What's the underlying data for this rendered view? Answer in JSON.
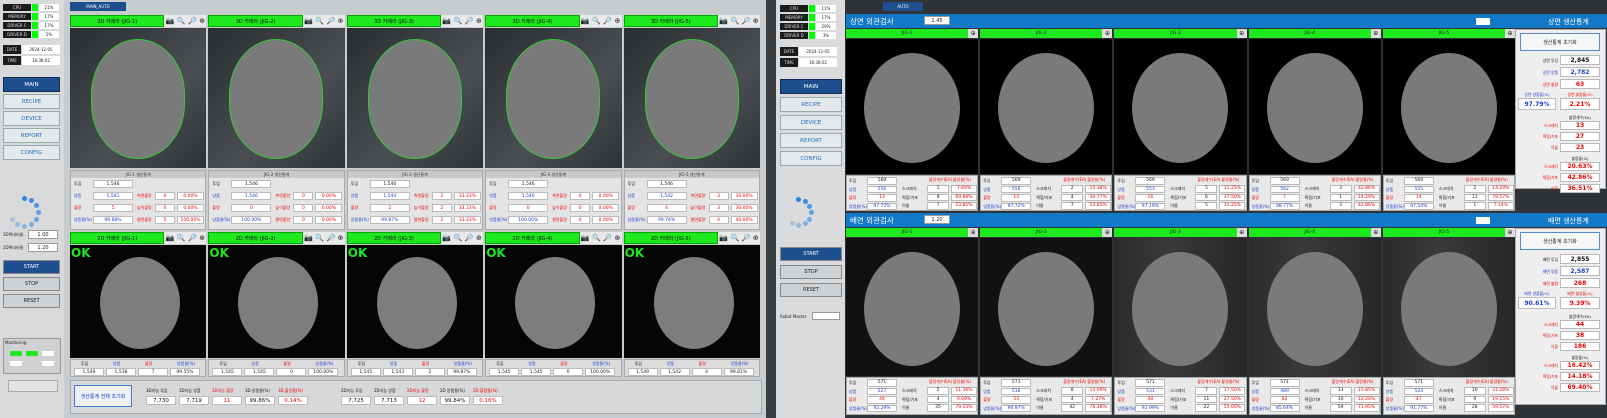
{
  "left": {
    "mode_tab": "MAIN_AUTO",
    "sys": [
      {
        "label": "CPU",
        "value": "21%"
      },
      {
        "label": "MEMORY",
        "value": "17%"
      },
      {
        "label": "DRIVER C",
        "value": "17%"
      },
      {
        "label": "DRIVER D",
        "value": "5%"
      }
    ],
    "date_label": "DATE",
    "date": "2024-12-05",
    "time_label": "TIME",
    "time": "16:38:02",
    "nav": [
      "MAIN",
      "RECIPE",
      "DEVICE",
      "REPORT",
      "CONFIG"
    ],
    "ctrl": [
      "START",
      "STOP",
      "RESET"
    ],
    "z1_label": "3D확대비율",
    "z1": "1.00",
    "z2_label": "2D확대비율",
    "z2": "1.20",
    "monitoring": "Monitoring",
    "cams3d": [
      "3D 카메라 (JIG-1)",
      "3D 카메라 (JIG-2)",
      "3D 카메라 (JIG-3)",
      "3D 카메라 (JIG-4)",
      "3D 카메라 (JIG-5)"
    ],
    "cams2d": [
      "2D 카메라 (JIG-1)",
      "2D 카메라 (JIG-2)",
      "2D 카메라 (JIG-3)",
      "2D 카메라 (JIG-4)",
      "2D 카메라 (JIG-5)"
    ],
    "ok": "OK",
    "stats3d": [
      {
        "title": "JIG-1 생산통계",
        "in": "1,546",
        "good": "1,541",
        "ng": "5",
        "rate": "99.68%",
        "bad1": "0",
        "p1": "0.00%",
        "bad2": "0",
        "p2": "0.00%",
        "bad3": "5",
        "p3": "100.00%"
      },
      {
        "title": "JIG-2 생산통계",
        "in": "1,546",
        "good": "1,546",
        "ng": "0",
        "rate": "100.00%",
        "bad1": "0",
        "p1": "0.00%",
        "bad2": "0",
        "p2": "0.00%",
        "bad3": "0",
        "p3": "0.00%"
      },
      {
        "title": "JIG-3 생산통계",
        "in": "1,546",
        "good": "1,544",
        "ng": "2",
        "rate": "99.87%",
        "bad1": "2",
        "p1": "33.33%",
        "bad2": "2",
        "p2": "33.33%",
        "bad3": "2",
        "p3": "33.33%"
      },
      {
        "title": "JIG-4 생산통계",
        "in": "1,546",
        "good": "1,546",
        "ng": "0",
        "rate": "100.00%",
        "bad1": "0",
        "p1": "0.00%",
        "bad2": "0",
        "p2": "0.00%",
        "bad3": "0",
        "p3": "0.00%"
      },
      {
        "title": "JIG-5 생산통계",
        "in": "1,546",
        "good": "1,542",
        "ng": "4",
        "rate": "99.74%",
        "bad1": "3",
        "p1": "30.00%",
        "bad2": "3",
        "p2": "30.00%",
        "bad3": "4",
        "p3": "40.00%"
      }
    ],
    "stats2d": [
      {
        "in": "1,549",
        "good": "1,538",
        "ng": "7",
        "rate": "99.55%"
      },
      {
        "in": "1,545",
        "good": "1,545",
        "ng": "0",
        "rate": "100.00%"
      },
      {
        "in": "1,545",
        "good": "1,543",
        "ng": "2",
        "rate": "99.87%"
      },
      {
        "in": "1,545",
        "good": "1,545",
        "ng": "0",
        "rate": "100.00%"
      },
      {
        "in": "1,549",
        "good": "1,542",
        "ng": "4",
        "rate": "99.81%"
      }
    ],
    "sumlabels": {
      "in": "투입",
      "good": "양품",
      "ng": "불량",
      "rate": "양품율(%)"
    },
    "tablabels": {
      "in": "투입",
      "good": "양품",
      "ng": "불량",
      "rate": "양품율(%)",
      "b1": "측면불량",
      "b2": "높이불량",
      "b3": "평면불량"
    },
    "reset_all": "생산통계 전체 초기화",
    "tot3d": {
      "in_l": "3D지능 투입",
      "in": "7,730",
      "good_l": "3D지능 양품",
      "good": "7,719",
      "ng_l": "3D지능 불량",
      "ng": "11",
      "rate_l": "3D 양품율(%)",
      "rate": "99.86%",
      "ngr_l": "3D 불량율(%)",
      "ngr": "0.14%"
    },
    "tot2d": {
      "in_l": "2D지능 투입",
      "in": "7,725",
      "good_l": "2D지능 양품",
      "good": "7,713",
      "ng_l": "2D지능 불량",
      "ng": "12",
      "rate_l": "2D 양품율(%)",
      "rate": "99.84%",
      "ngr_l": "2D 불량율(%)",
      "ngr": "0.16%"
    }
  },
  "right": {
    "mode_tab": "AUTO",
    "sys": [
      {
        "label": "CPU",
        "value": "11%"
      },
      {
        "label": "MEMORY",
        "value": "17%"
      },
      {
        "label": "DRIVER C",
        "value": "29%"
      },
      {
        "label": "DRIVER D",
        "value": "3%"
      }
    ],
    "date_label": "DATE",
    "date": "2024-12-05",
    "time_label": "TIME",
    "time": "16:38:02",
    "nav": [
      "MAIN",
      "RECIPE",
      "DEVICE",
      "REPORT",
      "CONFIG"
    ],
    "ctrl": [
      "START",
      "STOP",
      "RESET"
    ],
    "robot_label": "Robot Master",
    "top_title": "상면 외관검사",
    "top_zoom": "1.45",
    "bot_title": "배면 외관검사",
    "bot_zoom": "1.20",
    "top_stat_title": "상면 생산통계",
    "bot_stat_title": "배면 생산통계",
    "stat_reset": "생산통계 초기화",
    "jigs": [
      "JIG-1",
      "JIG-2",
      "JIG-3",
      "JIG-4",
      "JIG-5"
    ],
    "top_jig": [
      {
        "in": "569",
        "good": "556",
        "ng": "13",
        "rate": "97.72%",
        "v1": "1",
        "r1": "7.69%",
        "v2": "9",
        "r2": "69.66%",
        "v3": "7",
        "r3": "53.85%"
      },
      {
        "in": "569",
        "good": "556",
        "ng": "13",
        "rate": "97.72%",
        "v1": "2",
        "r1": "15.38%",
        "v2": "4",
        "r2": "30.77%",
        "v3": "7",
        "r3": "53.85%"
      },
      {
        "in": "569",
        "good": "553",
        "ng": "16",
        "rate": "97.19%",
        "v1": "5",
        "r1": "31.25%",
        "v2": "6",
        "r2": "37.50%",
        "v3": "5",
        "r3": "31.25%"
      },
      {
        "in": "569",
        "good": "562",
        "ng": "7",
        "rate": "98.77%",
        "v1": "3",
        "r1": "42.86%",
        "v2": "1",
        "r2": "14.29%",
        "v3": "3",
        "r3": "42.86%"
      },
      {
        "in": "569",
        "good": "555",
        "ng": "14",
        "rate": "97.54%",
        "v1": "2",
        "r1": "14.29%",
        "v2": "11",
        "r2": "78.57%",
        "v3": "1",
        "r3": "7.14%"
      }
    ],
    "bot_jig": [
      {
        "in": "571",
        "good": "527",
        "ng": "44",
        "rate": "92.29%",
        "v1": "5",
        "r1": "11.36%",
        "v2": "4",
        "r2": "9.09%",
        "v3": "35",
        "r3": "79.55%"
      },
      {
        "in": "571",
        "good": "518",
        "ng": "53",
        "rate": "90.97%",
        "v1": "8",
        "r1": "15.09%",
        "v2": "4",
        "r2": "7.27%",
        "v3": "42",
        "r3": "76.36%"
      },
      {
        "in": "571",
        "good": "531",
        "ng": "40",
        "rate": "92.99%",
        "v1": "7",
        "r1": "17.50%",
        "v2": "11",
        "r2": "27.50%",
        "v3": "22",
        "r3": "55.00%"
      },
      {
        "in": "571",
        "good": "489",
        "ng": "82",
        "rate": "85.64%",
        "v1": "13",
        "r1": "15.85%",
        "v2": "10",
        "r2": "12.20%",
        "v3": "59",
        "r3": "71.95%"
      },
      {
        "in": "571",
        "good": "524",
        "ng": "47",
        "rate": "91.77%",
        "v1": "10",
        "r1": "21.28%",
        "v2": "9",
        "r2": "19.15%",
        "v3": "28",
        "r3": "59.57%"
      }
    ],
    "jiglabels": {
      "in": "투입",
      "good": "양품",
      "ng": "불량",
      "rate": "양품율(%)",
      "l1": "스크래치",
      "l2": "찍힘/기포",
      "l3": "이물",
      "h1": "불량개수(EA)",
      "h2": "불량율(%)"
    },
    "top_stats": {
      "in_l": "상면 투입",
      "in": "2,845",
      "good_l": "상면 양품",
      "good": "2,782",
      "ng_l": "상면 불량",
      "ng": "63",
      "rate_l": "상면 양품율(%)",
      "rate": "97.79%",
      "ngr_l": "상면 불량율(%)",
      "ngr": "2.21%",
      "cnt_l": "불량개수(EA)",
      "c1_l": "스크래치",
      "c1": "13",
      "c2_l": "찍힘/기포",
      "c2": "27",
      "c3_l": "이물",
      "c3": "23",
      "pct_l": "불량율(%)",
      "p1": "20.63%",
      "p2": "42.86%",
      "p3": "36.51%"
    },
    "bot_stats": {
      "in_l": "배면 투입",
      "in": "2,855",
      "good_l": "배면 양품",
      "good": "2,587",
      "ng_l": "배면 불량",
      "ng": "268",
      "rate_l": "배면 양품율(%)",
      "rate": "90.61%",
      "ngr_l": "배면 불량율(%)",
      "ngr": "9.39%",
      "cnt_l": "불량개수(EA)",
      "c1_l": "스크래치",
      "c1": "44",
      "c2_l": "찍힘/기포",
      "c2": "38",
      "c3_l": "이물",
      "c3": "186",
      "pct_l": "불량율(%)",
      "p1": "16.42%",
      "p2": "14.18%",
      "p3": "69.40%"
    }
  }
}
